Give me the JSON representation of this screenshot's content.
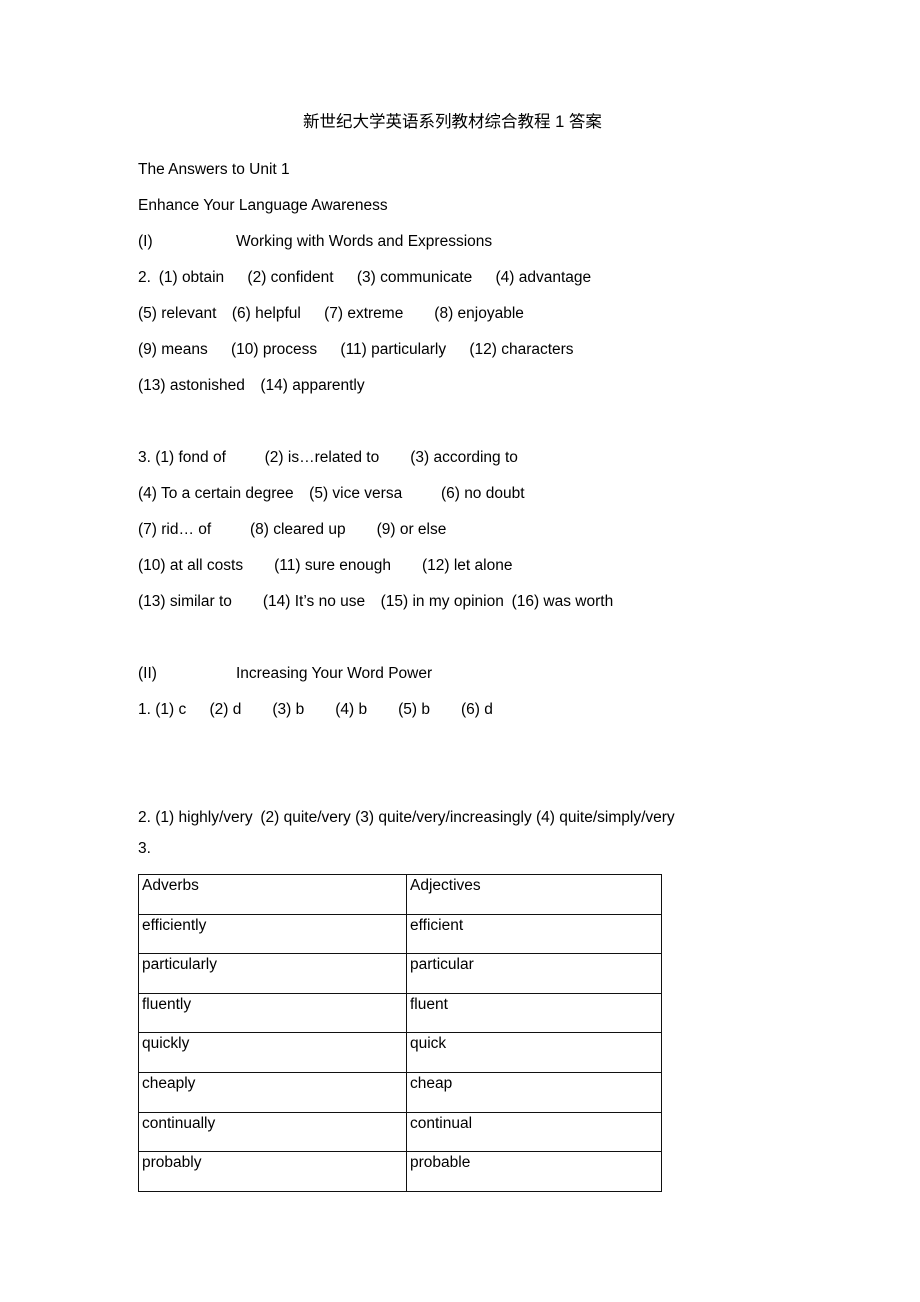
{
  "document": {
    "title_cn": "新世纪大学英语系列教材综合教程 1 答案",
    "subtitle": "The Answers to Unit 1",
    "section_heading": "Enhance Your Language Awareness"
  },
  "part_one": {
    "numeral": "(I)",
    "heading": "Working with Words and Expressions",
    "exercise2": {
      "number": "2.",
      "lines": [
        "(1) obtain  (2) confident  (3) communicate  (4) advantage",
        "(5) relevant  (6) helpful  (7) extreme   (8) enjoyable",
        "(9) means  (10) process  (11) particularly  (12) characters",
        "(13) astonished  (14) apparently"
      ]
    },
    "exercise3": {
      "number": "3.",
      "lines": [
        "(1) fond of   (2) is…related to  (3) according to",
        "(4) To a certain degree  (5) vice versa   (6) no doubt",
        "(7) rid… of   (8) cleared up  (9) or else",
        "(10) at all costs   (11) sure enough  (12) let alone",
        "(13) similar to  (14) It’s no use  (15) in my opinion (16) was worth"
      ]
    }
  },
  "part_two": {
    "numeral": "(II)",
    "heading": "Increasing Your Word Power",
    "exercise1": {
      "number": "1.",
      "line": "(1) c  (2) d   (3) b   (4) b   (5) b   (6) d"
    },
    "exercise2": {
      "number": "2.",
      "line": "(1) highly/very (2) quite/very (3) quite/very/increasingly (4) quite/simply/very"
    },
    "exercise3": {
      "number": "3.",
      "table": {
        "headers": [
          "Adverbs",
          "Adjectives"
        ],
        "rows": [
          [
            "efficiently",
            "efficient"
          ],
          [
            "particularly",
            "particular"
          ],
          [
            "fluently",
            "fluent"
          ],
          [
            "quickly",
            "quick"
          ],
          [
            "cheaply",
            "cheap"
          ],
          [
            "continually",
            "continual"
          ],
          [
            "probably",
            "probable"
          ]
        ]
      }
    }
  }
}
